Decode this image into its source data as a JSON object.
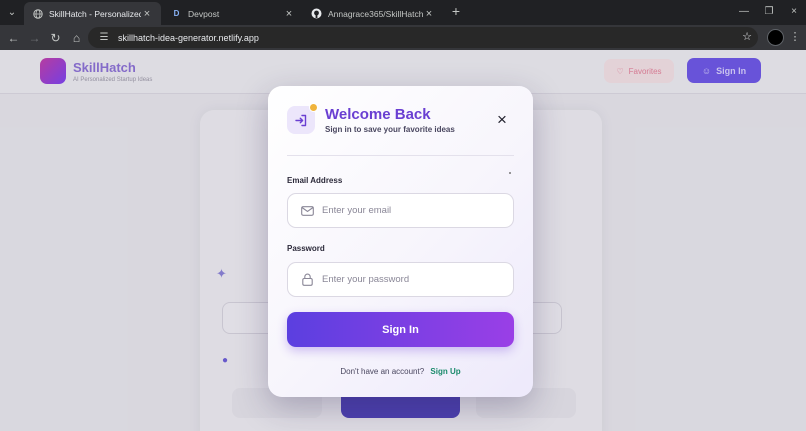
{
  "browser": {
    "tabs": [
      {
        "title": "SkillHatch - Personalized Startu",
        "favicon": "globe-icon"
      },
      {
        "title": "Devpost",
        "favicon": "D"
      },
      {
        "title": "Annagrace365/SkillHatch",
        "favicon": "github-icon"
      }
    ],
    "url": "skillhatch-idea-generator.netlify.app"
  },
  "app": {
    "brand": "SkillHatch",
    "tagline": "AI Personalized Startup Ideas",
    "favorites_label": "Favorites",
    "signin_label": "Sign In"
  },
  "modal": {
    "title": "Welcome Back",
    "subtitle": "Sign in to save your favorite ideas",
    "email_label": "Email Address",
    "email_placeholder": "Enter your email",
    "password_label": "Password",
    "password_placeholder": "Enter your password",
    "submit_label": "Sign In",
    "switch_prompt": "Don't have an account?",
    "switch_link": "Sign Up"
  },
  "colors": {
    "accent": "#6a3fd2",
    "button_start": "#5b3fe0",
    "button_end": "#9a3fe6",
    "link": "#1a8a6b"
  }
}
